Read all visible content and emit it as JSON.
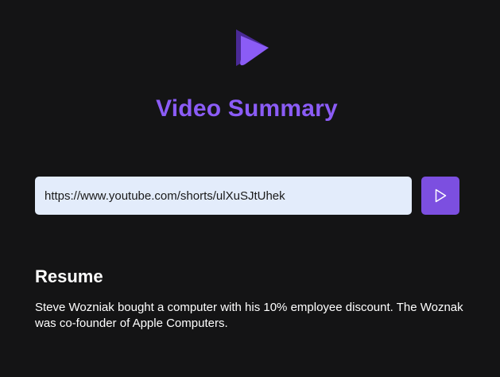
{
  "app": {
    "title": "Video Summary",
    "logo_icon": "play-logo-icon",
    "accent_color": "#8b5cf6"
  },
  "search": {
    "value": "https://www.youtube.com/shorts/ulXuSJtUhek",
    "submit_icon": "play-icon"
  },
  "result": {
    "heading": "Resume",
    "text": "Steve Wozniak bought a computer with his 10% employee discount. The Woznak was co-founder of Apple Computers."
  }
}
